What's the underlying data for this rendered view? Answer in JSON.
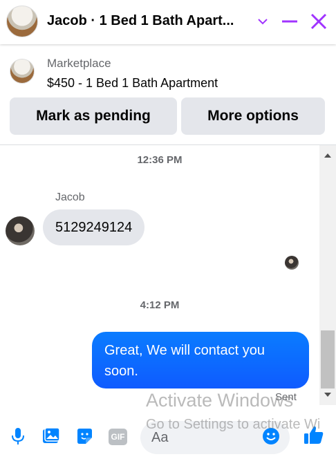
{
  "header": {
    "title": "Jacob · 1 Bed 1 Bath Apart...",
    "accent_color": "#a033ff",
    "icons": [
      "chevron-down-icon",
      "minimize-icon",
      "close-icon"
    ]
  },
  "listing": {
    "label": "Marketplace",
    "title": "$450 - 1 Bed 1 Bath Apartment"
  },
  "actions": {
    "pending": "Mark as pending",
    "more": "More options"
  },
  "messages": {
    "time_1": "12:36 PM",
    "sender": "Jacob",
    "incoming_text": "5129249124",
    "time_2": "4:12 PM",
    "outgoing_text": "Great, We will contact you soon.",
    "status": "Sent",
    "outgoing_color": "#0a7cff"
  },
  "composer": {
    "placeholder": "Aa",
    "gif_label": "GIF",
    "icons": [
      "microphone-icon",
      "photo-icon",
      "sticker-icon",
      "gif-icon",
      "emoji-icon",
      "thumbs-up-icon"
    ],
    "icon_color": "#0084ff"
  },
  "watermark": {
    "line1": "Activate Windows",
    "line2": "Go to Settings to activate Wi"
  }
}
